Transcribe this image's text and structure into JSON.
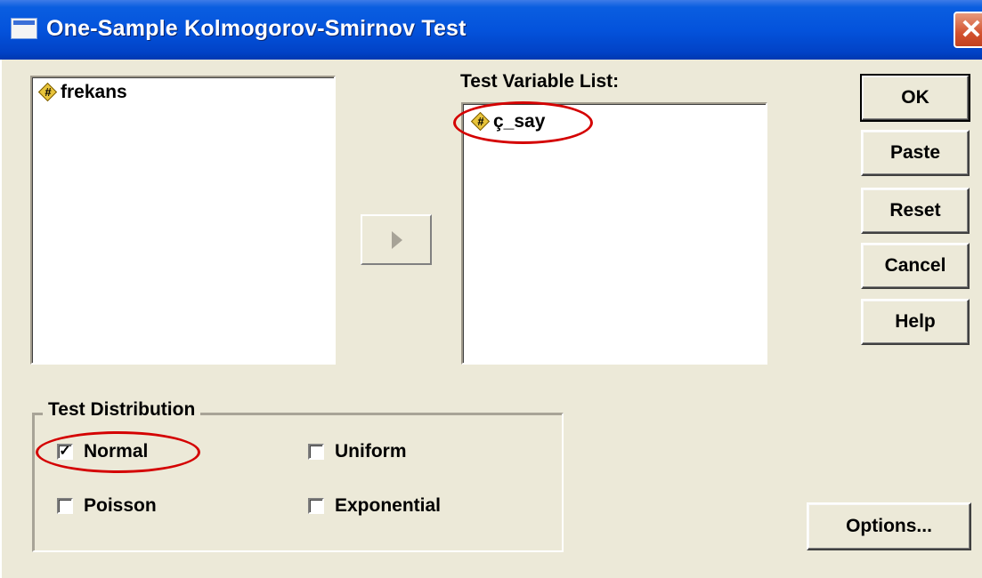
{
  "window": {
    "title": "One-Sample Kolmogorov-Smirnov Test",
    "close_glyph": "✕"
  },
  "source_list": {
    "items": [
      {
        "label": "frekans",
        "icon": "numeric-variable-icon"
      }
    ]
  },
  "test_variable_list": {
    "label": "Test Variable List:",
    "items": [
      {
        "label": "ç_say",
        "icon": "numeric-variable-icon"
      }
    ]
  },
  "buttons": {
    "ok": "OK",
    "paste": "Paste",
    "reset": "Reset",
    "cancel": "Cancel",
    "help": "Help",
    "options": "Options..."
  },
  "test_distribution": {
    "legend": "Test Distribution",
    "options": [
      {
        "label": "Normal",
        "checked": true
      },
      {
        "label": "Uniform",
        "checked": false
      },
      {
        "label": "Poisson",
        "checked": false
      },
      {
        "label": "Exponential",
        "checked": false
      }
    ],
    "check_glyph": "✓"
  },
  "colors": {
    "highlight_ellipse": "#d40000",
    "title_bar": "#0453dc",
    "dialog_bg": "#ece9d8"
  }
}
